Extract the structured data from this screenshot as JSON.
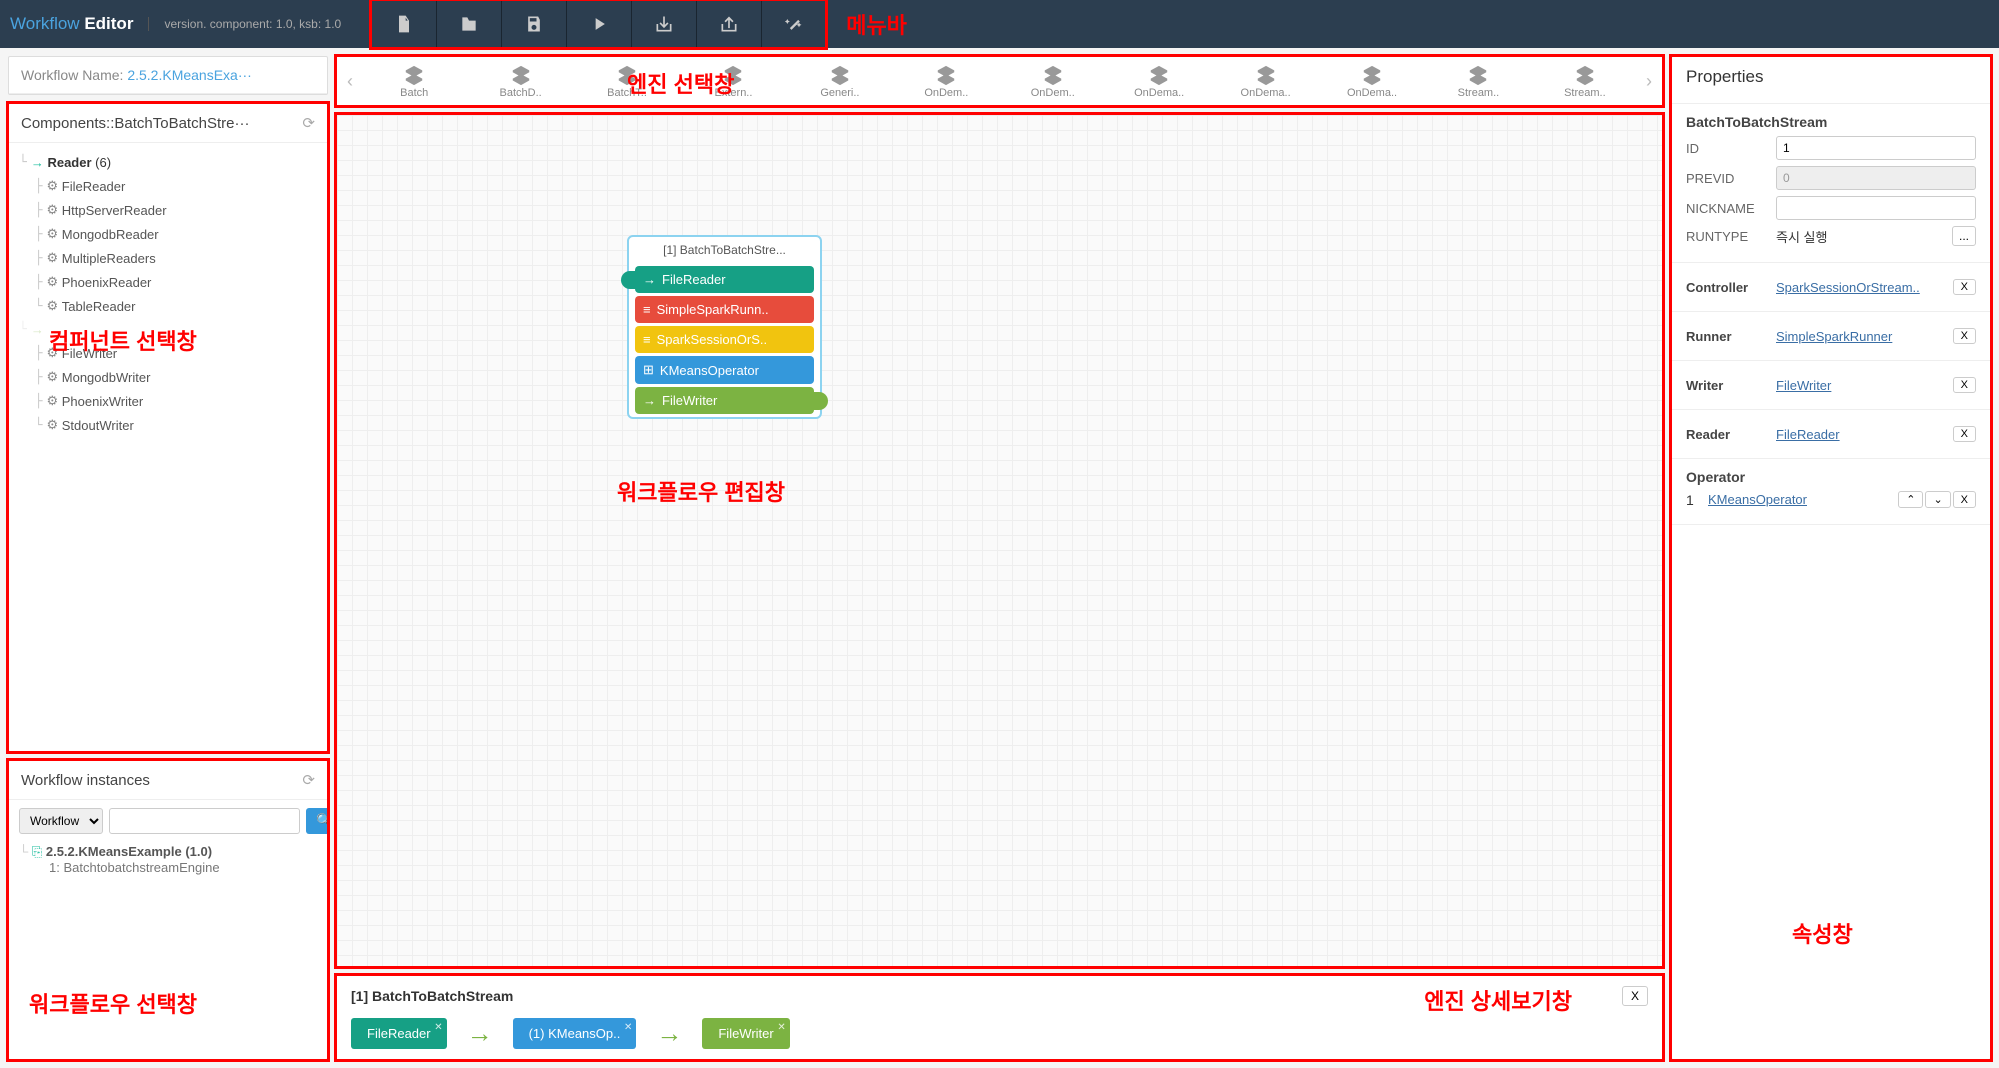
{
  "header": {
    "logo_workflow": "Workflow",
    "logo_editor": "Editor",
    "version_text": "version. component: 1.0, ksb: 1.0"
  },
  "annotations": {
    "menubar": "메뉴바",
    "engine_select": "엔진 선택창",
    "component_select": "컴퍼넌트 선택창",
    "workflow_edit": "워크플로우 편집창",
    "workflow_select": "워크플로우 선택창",
    "engine_detail": "엔진 상세보기창",
    "properties": "속성창"
  },
  "left": {
    "workflow_name_label": "Workflow Name:",
    "workflow_name_value": "2.5.2.KMeansExa···",
    "components_title": "Components::BatchToBatchStre···",
    "tree": {
      "reader": {
        "label": "Reader",
        "count": "(6)",
        "items": [
          "FileReader",
          "HttpServerReader",
          "MongodbReader",
          "MultipleReaders",
          "PhoenixReader",
          "TableReader"
        ]
      },
      "writer": {
        "items": [
          "FileWriter",
          "MongodbWriter",
          "PhoenixWriter",
          "StdoutWriter"
        ]
      }
    },
    "instances": {
      "title": "Workflow instances",
      "select": "Workflow",
      "item_title": "2.5.2.KMeansExample (1.0)",
      "item_sub": "1: BatchtobatchstreamEngine"
    }
  },
  "engines": [
    "Batch",
    "BatchD..",
    "BatchT..",
    "Extern..",
    "Generi..",
    "OnDem..",
    "OnDem..",
    "OnDema..",
    "OnDema..",
    "OnDema..",
    "Stream..",
    "Stream.."
  ],
  "canvas": {
    "node_title": "[1] BatchToBatchStre...",
    "rows": [
      {
        "label": "FileReader",
        "color": "c-teal",
        "icon": "→"
      },
      {
        "label": "SimpleSparkRunn..",
        "color": "c-red",
        "icon": "≡"
      },
      {
        "label": "SparkSessionOrS..",
        "color": "c-amber",
        "icon": "≡"
      },
      {
        "label": "KMeansOperator",
        "color": "c-blue",
        "icon": "⊞"
      },
      {
        "label": "FileWriter",
        "color": "c-green",
        "icon": "→"
      }
    ]
  },
  "detail": {
    "title": "[1] BatchToBatchStream",
    "close": "X",
    "chips": [
      {
        "label": "FileReader",
        "color": "c-teal"
      },
      {
        "label": "(1) KMeansOp..",
        "color": "c-blue"
      },
      {
        "label": "FileWriter",
        "color": "c-green"
      }
    ]
  },
  "properties": {
    "title": "Properties",
    "sub": "BatchToBatchStream",
    "fields": {
      "id_label": "ID",
      "id_value": "1",
      "previd_label": "PREVID",
      "previd_value": "0",
      "nick_label": "NICKNAME",
      "nick_value": "",
      "runtype_label": "RUNTYPE",
      "runtype_value": "즉시 실행"
    },
    "links": [
      {
        "label": "Controller",
        "value": "SparkSessionOrStream.."
      },
      {
        "label": "Runner",
        "value": "SimpleSparkRunner"
      },
      {
        "label": "Writer",
        "value": "FileWriter"
      },
      {
        "label": "Reader",
        "value": "FileReader"
      }
    ],
    "operator": {
      "label": "Operator",
      "idx": "1",
      "value": "KMeansOperator"
    }
  }
}
